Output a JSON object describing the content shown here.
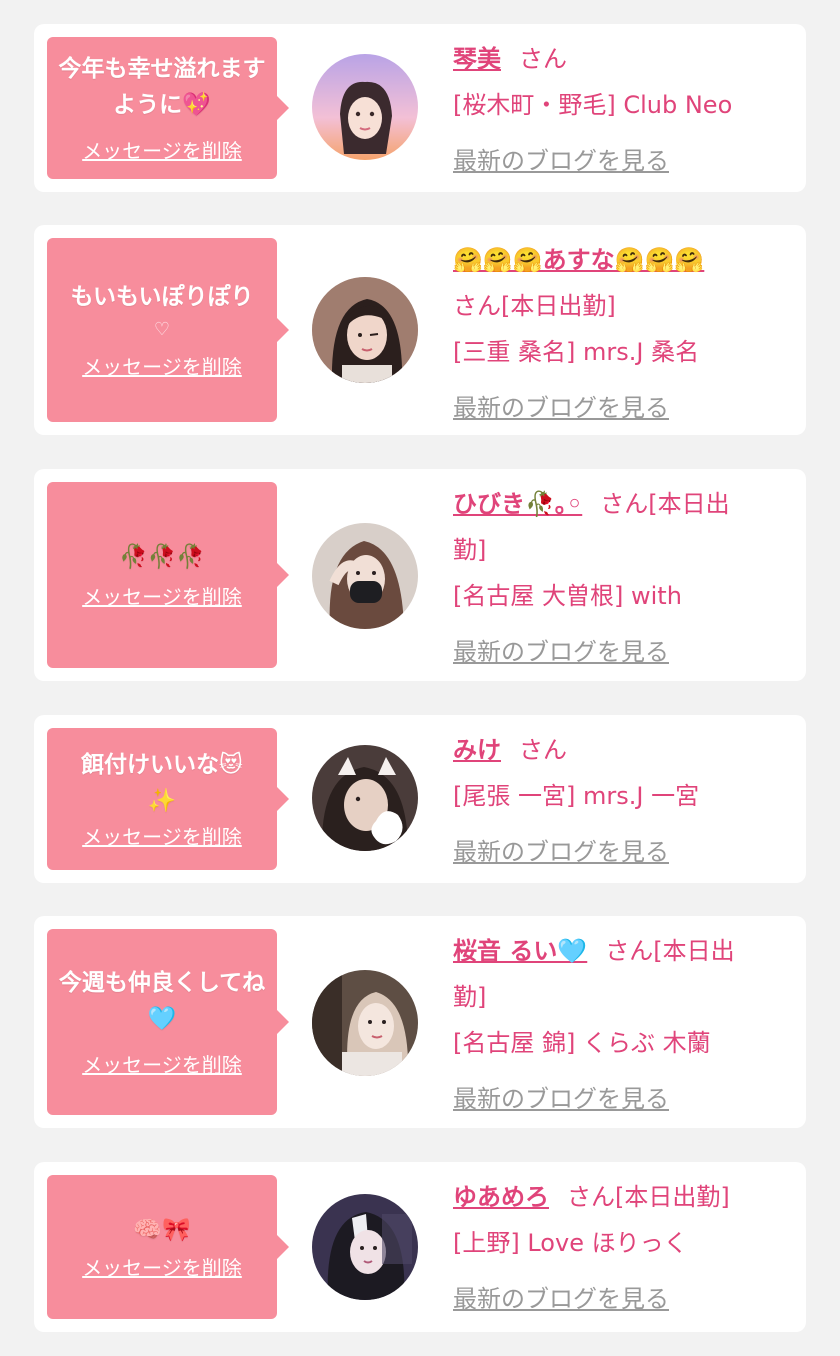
{
  "cards": [
    {
      "message": "今年も幸せ溢れますように💖",
      "delete_label": "メッセージを削除",
      "name": "琴美",
      "san": "さん",
      "shop": "[桜木町・野毛] Club Neo",
      "blog_link": "最新のブログを見る"
    },
    {
      "message": "もいもいぽりぽり",
      "heart": "♡",
      "delete_label": "メッセージを削除",
      "name": "🤗🤗🤗あすな🤗🤗🤗",
      "san_line": "さん[本日出勤]",
      "shop": "[三重 桑名] mrs.J 桑名",
      "blog_link": "最新のブログを見る"
    },
    {
      "message": "🥀🥀🥀",
      "delete_label": "メッセージを削除",
      "name": "ひびき🥀｡◦",
      "san": "さん[本日出",
      "san_cont": "勤]",
      "shop": "[名古屋 大曽根] with",
      "blog_link": "最新のブログを見る"
    },
    {
      "message": "餌付けいいな😻",
      "message2": "✨",
      "delete_label": "メッセージを削除",
      "name": "みけ",
      "san": "さん",
      "shop": "[尾張 一宮] mrs.J 一宮",
      "blog_link": "最新のブログを見る"
    },
    {
      "message": "今週も仲良くしてね🩵",
      "delete_label": "メッセージを削除",
      "name": "桜音 るい🩵",
      "san": "さん[本日出",
      "san_cont": "勤]",
      "shop": "[名古屋 錦] くらぶ 木蘭",
      "blog_link": "最新のブログを見る"
    },
    {
      "message": "🧠🎀",
      "delete_label": "メッセージを削除",
      "name": "ゆあめろ",
      "san": "さん[本日出勤]",
      "shop": "[上野] Love ほりっく",
      "blog_link": "最新のブログを見る"
    }
  ],
  "colors": {
    "background": "#f2f2f2",
    "card": "#ffffff",
    "bubble": "#f78d9c",
    "accent": "#e0447a",
    "link_gray": "#999999"
  }
}
